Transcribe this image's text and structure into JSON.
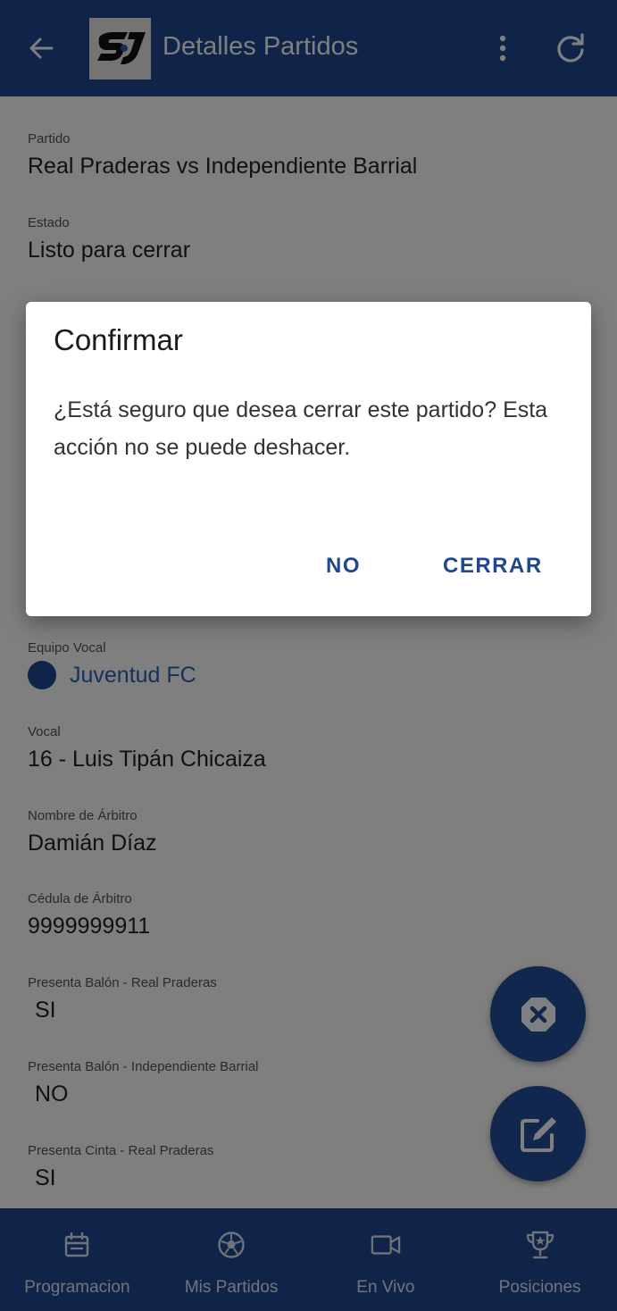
{
  "appbar": {
    "title": "Detalles Partidos",
    "back_icon": "arrow-left-icon",
    "logo": "sj-logo",
    "menu_icon": "more-vert-icon",
    "refresh_icon": "refresh-icon",
    "color": "#1f4891"
  },
  "details": {
    "partido_label": "Partido",
    "partido_value": "Real Praderas vs Independiente Barrial",
    "estado_label": "Estado",
    "estado_value": "Listo para cerrar",
    "equipo_vocal_label": "Equipo Vocal",
    "equipo_vocal_value": "Juventud FC",
    "vocal_label": "Vocal",
    "vocal_value": "16 - Luis Tipán Chicaiza",
    "arbitro_label": "Nombre de Árbitro",
    "arbitro_value": "Damián Díaz",
    "cedula_label": "Cédula de Árbitro",
    "cedula_value": "9999999911",
    "balon_rp_label": "Presenta Balón - Real Praderas",
    "balon_rp_value": "SI",
    "balon_ib_label": "Presenta Balón - Independiente Barrial",
    "balon_ib_value": "NO",
    "cinta_rp_label": "Presenta Cinta - Real Praderas",
    "cinta_rp_value": "SI"
  },
  "dialog": {
    "title": "Confirmar",
    "message": "¿Está seguro que desea cerrar este partido? Esta acción no se puede deshacer.",
    "no_label": "NO",
    "confirm_label": "CERRAR"
  },
  "fabs": {
    "close_icon": "close-octagon-icon",
    "edit_icon": "edit-icon"
  },
  "bottom_nav": {
    "items": [
      {
        "label": "Programacion",
        "icon": "calendar-icon"
      },
      {
        "label": "Mis Partidos",
        "icon": "soccer-ball-icon"
      },
      {
        "label": "En Vivo",
        "icon": "video-camera-icon"
      },
      {
        "label": "Posiciones",
        "icon": "trophy-icon"
      }
    ]
  }
}
